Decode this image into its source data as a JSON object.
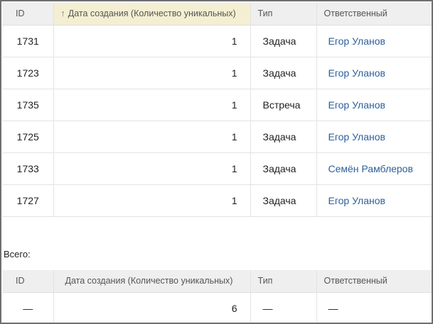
{
  "table": {
    "headers": {
      "id": "ID",
      "sort_arrow": "↑",
      "date": "Дата создания (Количество уникальных)",
      "type": "Тип",
      "responsible": "Ответственный"
    },
    "rows": [
      {
        "id": "1731",
        "count": "1",
        "type": "Задача",
        "responsible": "Егор Уланов"
      },
      {
        "id": "1723",
        "count": "1",
        "type": "Задача",
        "responsible": "Егор Уланов"
      },
      {
        "id": "1735",
        "count": "1",
        "type": "Встреча",
        "responsible": "Егор Уланов"
      },
      {
        "id": "1725",
        "count": "1",
        "type": "Задача",
        "responsible": "Егор Уланов"
      },
      {
        "id": "1733",
        "count": "1",
        "type": "Задача",
        "responsible": "Семён Рамблеров"
      },
      {
        "id": "1727",
        "count": "1",
        "type": "Задача",
        "responsible": "Егор Уланов"
      }
    ]
  },
  "totals": {
    "label": "Всего:",
    "headers": {
      "id": "ID",
      "date": "Дата создания (Количество уникальных)",
      "type": "Тип",
      "responsible": "Ответственный"
    },
    "row": {
      "id": "—",
      "count": "6",
      "type": "—",
      "responsible": "—"
    }
  },
  "colors": {
    "link": "#2d5f9a",
    "sorted_header_bg": "#f4efd2",
    "header_bg": "#efefef"
  }
}
